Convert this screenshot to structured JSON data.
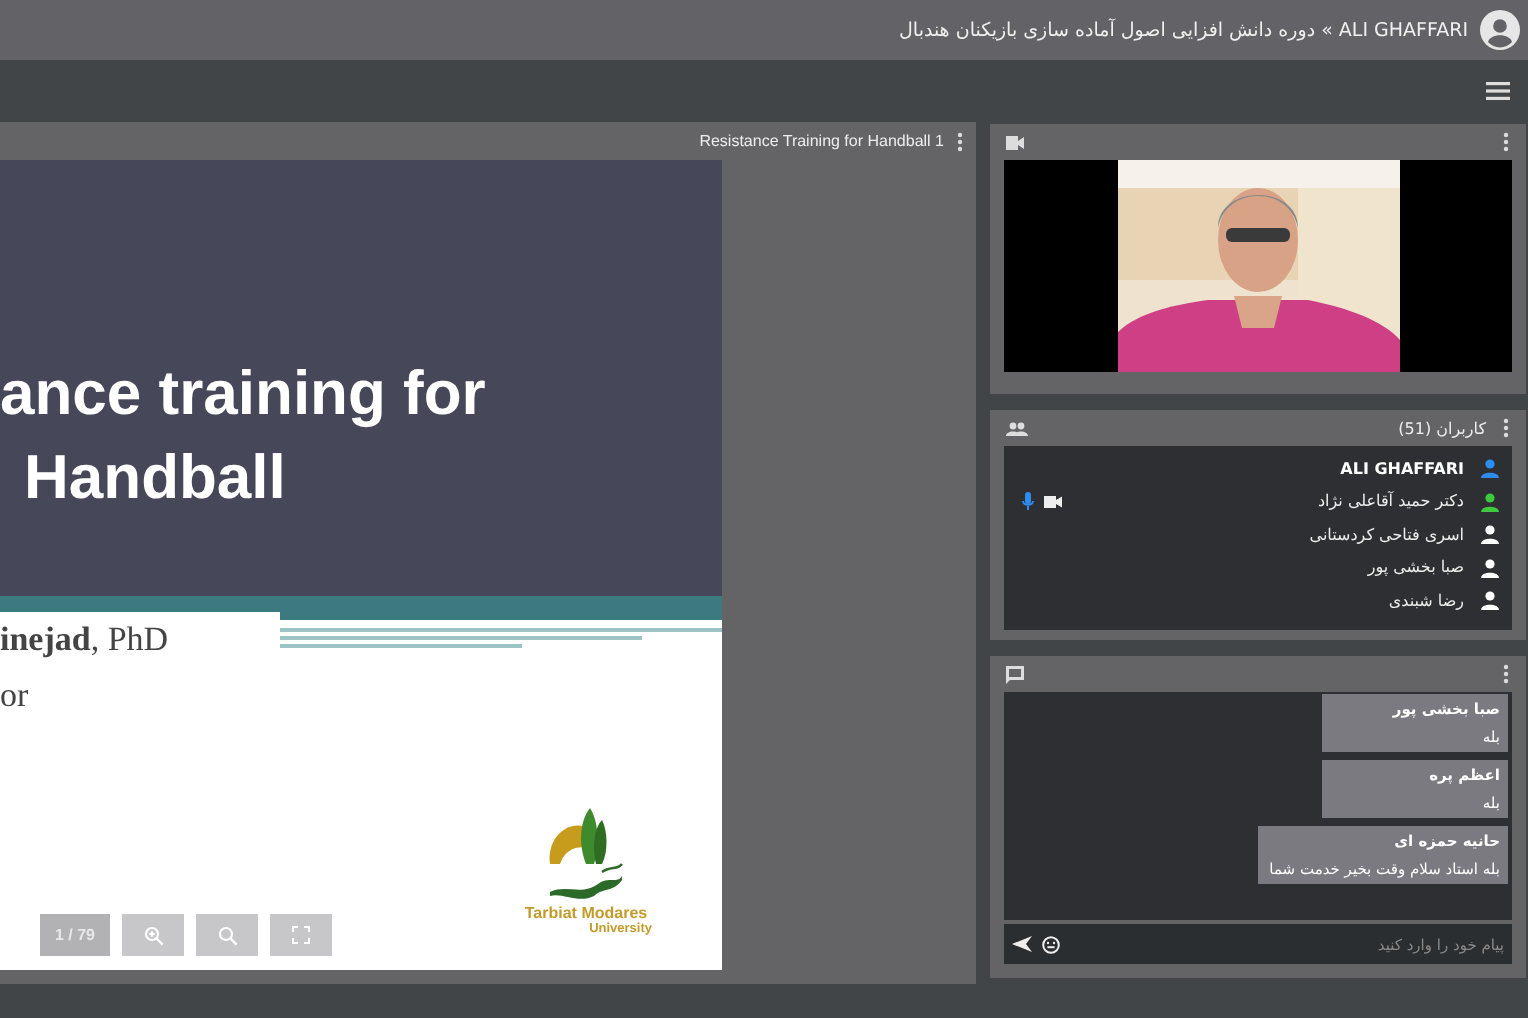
{
  "header": {
    "breadcrumb": "ALI GHAFFARI » دوره دانش افزایی اصول آماده سازی بازیکنان هندبال"
  },
  "presentation": {
    "title": "Resistance Training for Handball 1",
    "slide": {
      "title_lines": [
        "ance training for",
        "Handball"
      ],
      "author": "**inejad**, PhD",
      "role": "or",
      "logo_name": "Tarbiat Modares",
      "logo_sub": "University"
    },
    "page_counter": "1 / 79"
  },
  "users": {
    "title": "کاربران (51)",
    "items": [
      {
        "name": "ALI GHAFFARI",
        "color": "#2d8cf0",
        "bold": true,
        "mic": false,
        "camera": false
      },
      {
        "name": "دکتر حمید آقاعلی نژاد",
        "color": "#3ec93e",
        "bold": false,
        "mic": true,
        "camera": true
      },
      {
        "name": "اسری فتاحی کردستانی",
        "color": "#ffffff",
        "bold": false,
        "mic": false,
        "camera": false
      },
      {
        "name": "صبا بخشی پور",
        "color": "#ffffff",
        "bold": false,
        "mic": false,
        "camera": false
      },
      {
        "name": "رضا شبندی",
        "color": "#ffffff",
        "bold": false,
        "mic": false,
        "camera": false
      }
    ]
  },
  "chat": {
    "messages": [
      {
        "sender": "صبا بخشی پور",
        "text": "بله"
      },
      {
        "sender": "اعظم پره",
        "text": "بله"
      },
      {
        "sender": "حانیه حمزه ای",
        "text": "بله استاد سلام وقت بخیر خدمت شما"
      }
    ],
    "input": {
      "placeholder": "پیام خود را وارد کنید"
    }
  }
}
